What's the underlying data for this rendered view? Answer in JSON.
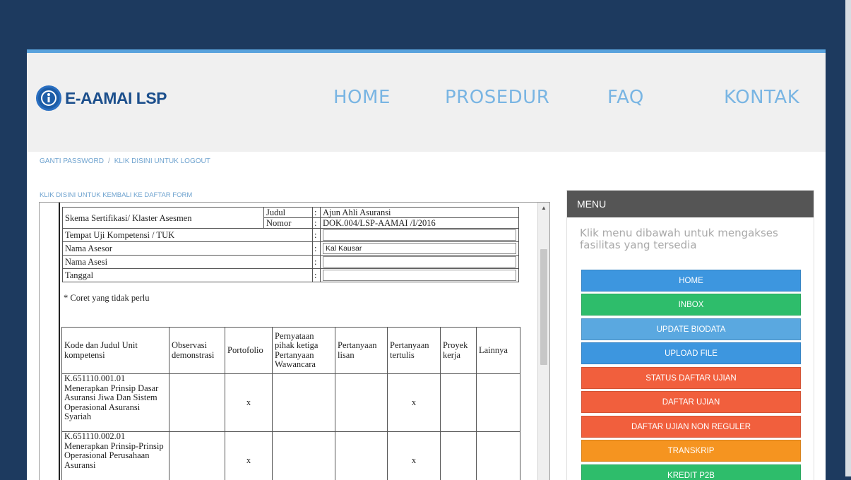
{
  "header": {
    "logo_text": "E-AAMAI LSP",
    "nav": [
      "HOME",
      "PROSEDUR",
      "FAQ",
      "KONTAK"
    ]
  },
  "top_links": {
    "change_password": "GANTI PASSWORD",
    "separator": "/",
    "logout": "KLIK DISINI UNTUK LOGOUT"
  },
  "back_link": "KLIK DISINI UNTUK KEMBALI KE DAFTAR FORM",
  "document": {
    "skema_label": "Skema Sertifikasi/ Klaster Asesmen",
    "judul_label": "Judul",
    "judul_value": "Ajun Ahli Asuransi",
    "nomor_label": "Nomor",
    "nomor_value": "DOK.004/LSP-AAMAI /I/2016",
    "colon": ":",
    "tuk_label": "Tempat Uji Kompetensi / TUK",
    "tuk_value": "",
    "asesor_label": "Nama Asesor",
    "asesor_value": "Kal Kausar",
    "asesi_label": "Nama Asesi",
    "asesi_value": "",
    "tanggal_label": "Tanggal",
    "tanggal_value": "",
    "note": "* Coret yang tidak perlu",
    "table_headers": [
      "Kode dan Judul Unit kompetensi",
      "Observasi demonstrasi",
      "Portofolio",
      "Pernyataan pihak ketiga Pertanyaan Wawancara",
      "Pertanyaan lisan",
      "Pertanyaan tertulis",
      "Proyek kerja",
      "Lainnya"
    ],
    "rows": [
      {
        "unit": "K.651110.001.01 Menerapkan Prinsip Dasar Asuransi Jiwa Dan Sistem Operasional Asuransi Syariah",
        "cells": [
          "",
          "x",
          "",
          "",
          "x",
          "",
          ""
        ]
      },
      {
        "unit": "K.651110.002.01 Menerapkan Prinsip-Prinsip Operasional Perusahaan Asuransi",
        "cells": [
          "",
          "x",
          "",
          "",
          "x",
          "",
          ""
        ]
      }
    ]
  },
  "menu": {
    "title": "MENU",
    "description": "Klik menu dibawah untuk mengakses fasilitas yang tersedia",
    "buttons": [
      {
        "label": "HOME",
        "color": "#3d96df"
      },
      {
        "label": "INBOX",
        "color": "#2ebd6b"
      },
      {
        "label": "UPDATE BIODATA",
        "color": "#5aa8e0"
      },
      {
        "label": "UPLOAD FILE",
        "color": "#3d96df"
      },
      {
        "label": "STATUS DAFTAR UJIAN",
        "color": "#f15f3d"
      },
      {
        "label": "DAFTAR UJIAN",
        "color": "#f15f3d"
      },
      {
        "label": "DAFTAR UJIAN NON REGULER",
        "color": "#f15f3d"
      },
      {
        "label": "TRANSKRIP",
        "color": "#f59420"
      },
      {
        "label": "KREDIT P2B",
        "color": "#2ebd6b"
      }
    ]
  }
}
